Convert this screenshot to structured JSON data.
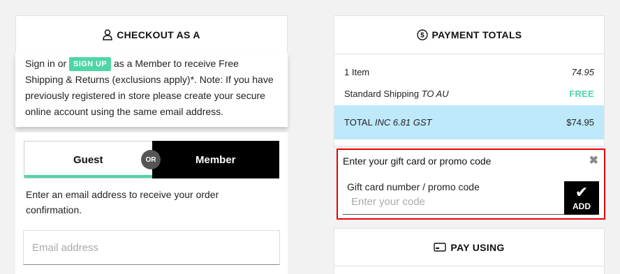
{
  "checkout": {
    "title": "CHECKOUT AS A",
    "signin_prefix": "Sign in or",
    "signup_label": "SIGN UP",
    "signin_suffix": "as a Member to receive Free Shipping & Returns (exclusions apply)*. Note: If you have previously registered in store please create your secure online account using the same email address."
  },
  "toggle": {
    "guest_label": "Guest",
    "or_label": "OR",
    "member_label": "Member"
  },
  "guest": {
    "instructions": "Enter an email address to receive your order confirmation.",
    "email_placeholder": "Email address"
  },
  "totals": {
    "title": "PAYMENT TOTALS",
    "items_label": "1 Item",
    "items_value": "74.95",
    "shipping_label": "Standard Shipping",
    "shipping_dest": "TO AU",
    "shipping_value": "FREE",
    "total_label": "TOTAL",
    "total_gst": "INC 6.81 GST",
    "total_value": "$74.95"
  },
  "promo": {
    "title": "Enter your gift card or promo code",
    "field_label": "Gift card number / promo code",
    "placeholder": "Enter your code",
    "add_label": "ADD"
  },
  "pay": {
    "title": "PAY USING"
  },
  "colors": {
    "accent": "#4fd6a6",
    "total_bg": "#bde9fb",
    "highlight_border": "#e00000"
  }
}
